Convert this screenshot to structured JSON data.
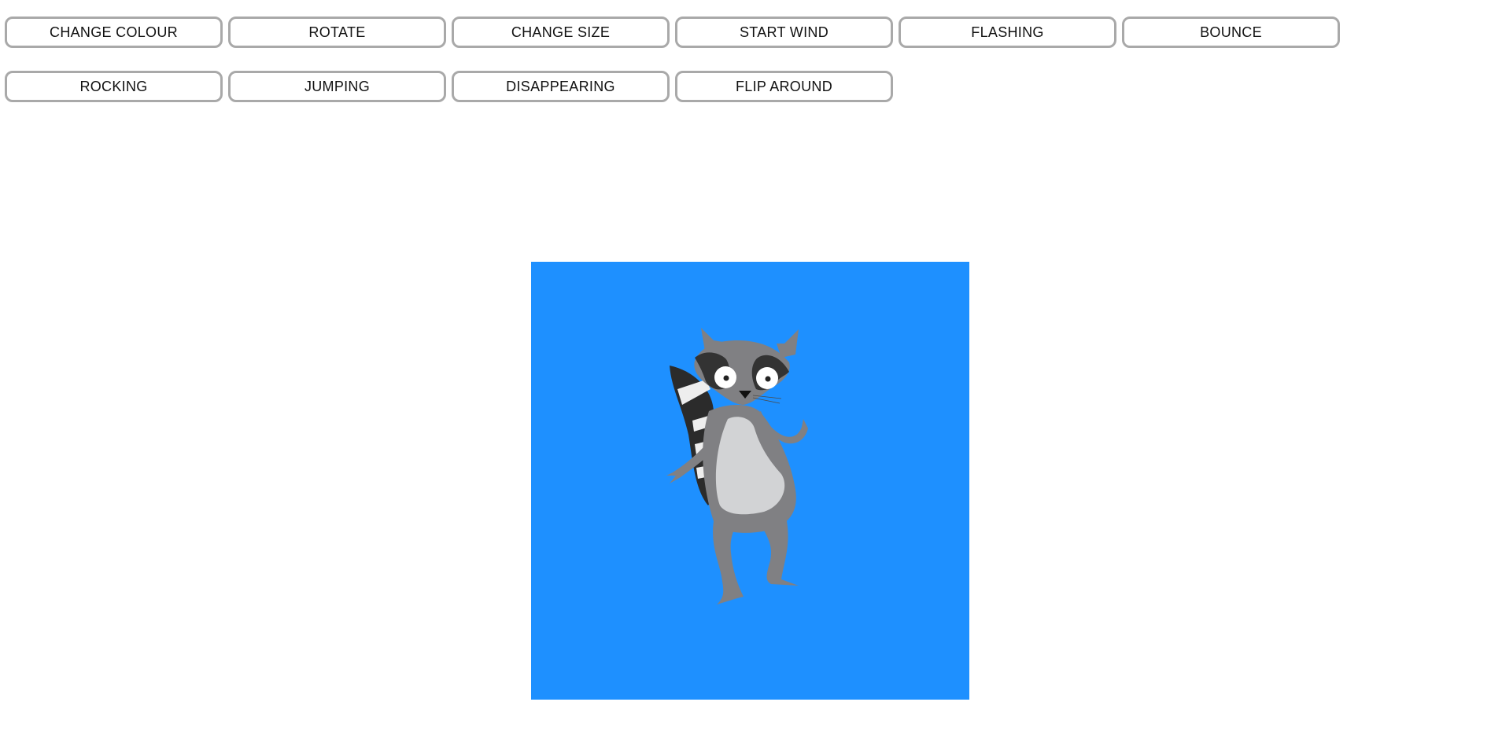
{
  "toolbar": {
    "row1": [
      {
        "label": "CHANGE COLOUR"
      },
      {
        "label": "ROTATE"
      },
      {
        "label": "CHANGE SIZE"
      },
      {
        "label": "START WIND"
      },
      {
        "label": "FLASHING"
      },
      {
        "label": "BOUNCE"
      }
    ],
    "row2": [
      {
        "label": "ROCKING"
      },
      {
        "label": "JUMPING"
      },
      {
        "label": "DISAPPEARING"
      },
      {
        "label": "FLIP AROUND"
      }
    ]
  },
  "stage": {
    "background_color": "#1e90ff",
    "character": "raccoon"
  },
  "colors": {
    "button_border": "#a9a9a9",
    "raccoon_body": "#808083",
    "raccoon_belly": "#d2d3d5",
    "raccoon_mask": "#333333"
  }
}
